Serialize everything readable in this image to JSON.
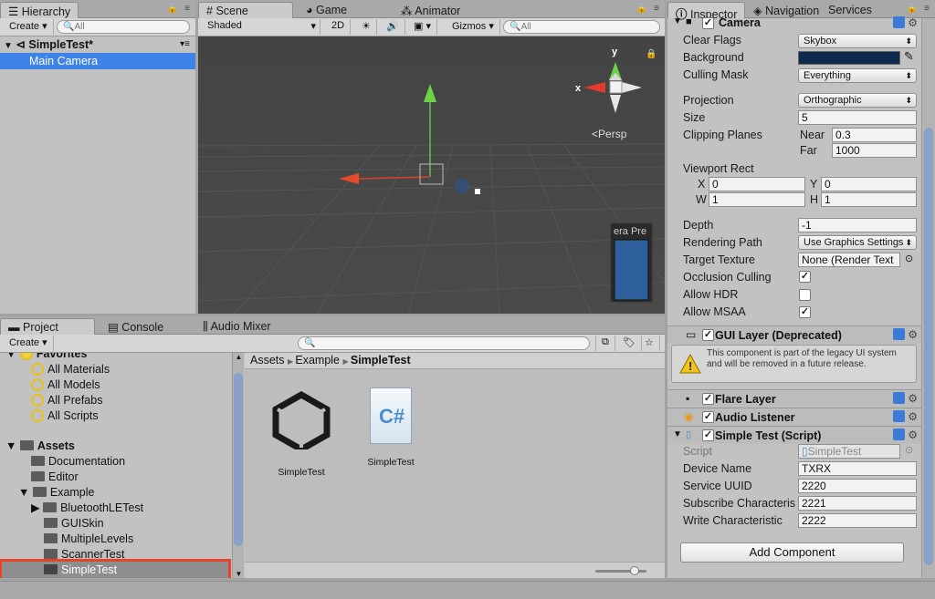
{
  "hierarchy": {
    "tab_label": "Hierarchy",
    "create_label": "Create",
    "search_placeholder": "All",
    "scene_name": "SimpleTest*",
    "items": [
      "Main Camera"
    ]
  },
  "scene_view": {
    "tabs": [
      "Scene",
      "Game",
      "Animator"
    ],
    "shading_mode": "Shaded",
    "mode_2d_label": "2D",
    "gizmos_label": "Gizmos",
    "search_placeholder": "All",
    "gizmo_axis_y": "y",
    "gizmo_axis_x": "x",
    "persp_label": "Persp",
    "camera_preview_label": "era Pre"
  },
  "project": {
    "tabs": [
      "Project",
      "Console",
      "Audio Mixer"
    ],
    "create_label": "Create",
    "favorites_label": "Favorites",
    "favorites": [
      "All Materials",
      "All Models",
      "All Prefabs",
      "All Scripts"
    ],
    "assets_label": "Assets",
    "asset_tree": [
      "Documentation",
      "Editor",
      "Example",
      "BluetoothLETest",
      "GUISkin",
      "MultipleLevels",
      "ScannerTest",
      "SimpleTest"
    ],
    "breadcrumb": [
      "Assets",
      "Example",
      "SimpleTest"
    ],
    "files": [
      {
        "name": "SimpleTest",
        "type": "unity-scene"
      },
      {
        "name": "SimpleTest",
        "type": "csharp-script"
      }
    ],
    "csharp_label": "C#"
  },
  "inspector": {
    "tabs": [
      "Inspector",
      "Navigation",
      "Services"
    ],
    "camera": {
      "title": "Camera",
      "clear_flags_label": "Clear Flags",
      "clear_flags_value": "Skybox",
      "background_label": "Background",
      "background_color": "#0e2a4e",
      "culling_mask_label": "Culling Mask",
      "culling_mask_value": "Everything",
      "projection_label": "Projection",
      "projection_value": "Orthographic",
      "size_label": "Size",
      "size_value": "5",
      "clipping_label": "Clipping Planes",
      "near_label": "Near",
      "near_value": "0.3",
      "far_label": "Far",
      "far_value": "1000",
      "viewport_label": "Viewport Rect",
      "x_label": "X",
      "x_value": "0",
      "y_label": "Y",
      "y_value": "0",
      "w_label": "W",
      "w_value": "1",
      "h_label": "H",
      "h_value": "1",
      "depth_label": "Depth",
      "depth_value": "-1",
      "rendering_path_label": "Rendering Path",
      "rendering_path_value": "Use Graphics Settings",
      "target_texture_label": "Target Texture",
      "target_texture_value": "None (Render Text",
      "occlusion_label": "Occlusion Culling",
      "occlusion_checked": true,
      "hdr_label": "Allow HDR",
      "hdr_checked": false,
      "msaa_label": "Allow MSAA",
      "msaa_checked": true
    },
    "gui_layer": {
      "title": "GUI Layer (Deprecated)",
      "warning": "This component is part of the legacy UI system and will be removed in a future release."
    },
    "flare_layer_title": "Flare Layer",
    "audio_listener_title": "Audio Listener",
    "simple_test": {
      "title": "Simple Test (Script)",
      "script_label": "Script",
      "script_value": "SimpleTest",
      "device_name_label": "Device Name",
      "device_name_value": "TXRX",
      "service_uuid_label": "Service UUID",
      "service_uuid_value": "2220",
      "subscribe_label": "Subscribe Characteris",
      "subscribe_value": "2221",
      "write_label": "Write Characteristic",
      "write_value": "2222"
    },
    "add_component_label": "Add Component"
  }
}
